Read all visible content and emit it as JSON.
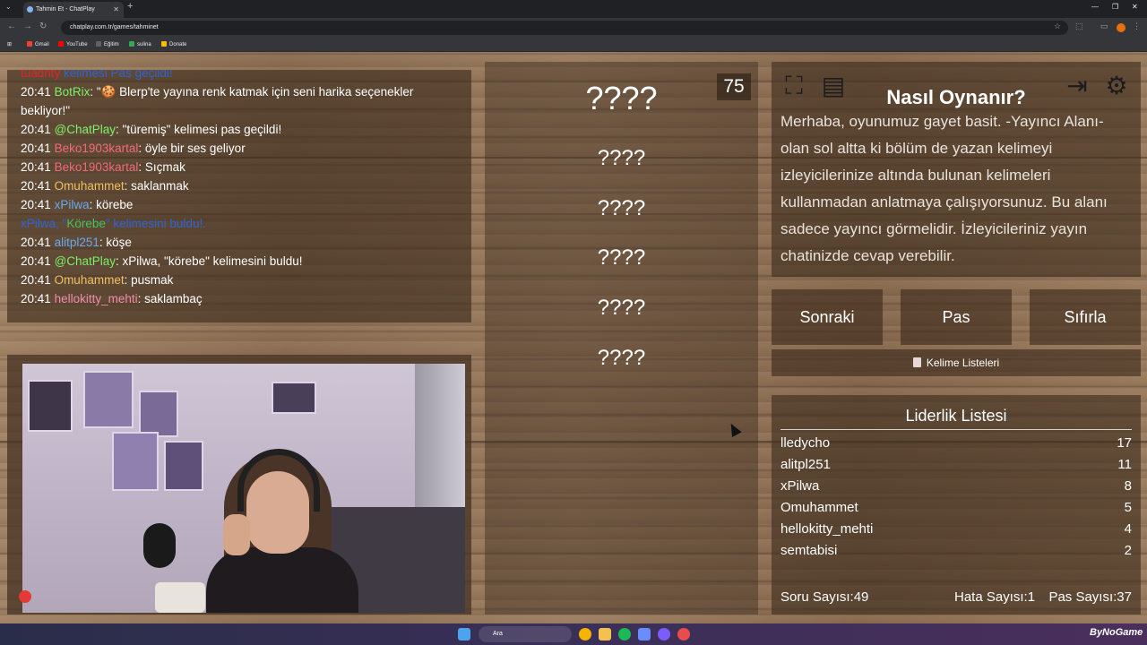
{
  "browser": {
    "tab_title": "Tahmin Et - ChatPlay",
    "url": "chatplay.com.tr/games/tahminet",
    "bookmarks": [
      "Gmail",
      "YouTube",
      "Eğitim",
      "sulina",
      "Donate"
    ],
    "taskbar_search": "Ara",
    "tray_text": "ByNoGame"
  },
  "chat": {
    "cut_line": {
      "user": "tuadnty",
      "text": " kelimesi Pas geçildi!"
    },
    "messages": [
      {
        "time": "20:41",
        "user": "BotRix",
        "color": "#7cf06a",
        "text": ": \"🍪 Blerp'te yayına renk katmak için seni harika seçenekler bekliyor!\""
      },
      {
        "time": "20:41",
        "user": "@ChatPlay",
        "color": "#7cf06a",
        "text": ": \"türemiş\" kelimesi pas geçildi!"
      },
      {
        "time": "20:41",
        "user": "Beko1903kartal",
        "color": "#f06a7a",
        "text": ": öyle bir ses geliyor"
      },
      {
        "time": "20:41",
        "user": "Beko1903kartal",
        "color": "#f06a7a",
        "text": ": Sıçmak"
      },
      {
        "time": "20:41",
        "user": "Omuhammet",
        "color": "#f0c060",
        "text": ": saklanmak"
      },
      {
        "time": "20:41",
        "user": "xPilwa",
        "color": "#6aa8f0",
        "text": ": körebe"
      },
      {
        "system": true,
        "text_pre": "xPilwa, \"",
        "word": "Körebe",
        "text_post": "\" kelimesini buldu!."
      },
      {
        "time": "20:41",
        "user": "alitpl251",
        "color": "#6aa8f0",
        "text": ": köşe"
      },
      {
        "time": "20:41",
        "user": "@ChatPlay",
        "color": "#7cf06a",
        "text": ": xPilwa, \"körebe\" kelimesini buldu!"
      },
      {
        "time": "20:41",
        "user": "Omuhammet",
        "color": "#f0c060",
        "text": ": pusmak"
      },
      {
        "time": "20:41",
        "user": "hellokitty_mehti",
        "color": "#f08aa8",
        "text": ": saklambaç"
      }
    ]
  },
  "game": {
    "timer": "75",
    "words": [
      "????",
      "????",
      "????",
      "????",
      "????",
      "????"
    ]
  },
  "howto": {
    "title": "Nasıl Oynanır?",
    "text": "Merhaba, oyunumuz gayet basit. -Yayıncı Alanı- olan sol altta ki bölüm de yazan kelimeyi izleyicilerinize altında bulunan kelimeleri kullanmadan anlatmaya çalışıyorsunuz. Bu alanı sadece yayıncı görmelidir. İzleyicileriniz yayın chatinizde cevap verebilir.",
    "icons": [
      "fullscreen-icon",
      "notes-icon",
      "exit-icon",
      "gear-icon"
    ]
  },
  "controls": {
    "next": "Sonraki",
    "pass": "Pas",
    "reset": "Sıfırla",
    "word_lists": "Kelime Listeleri"
  },
  "leaderboard": {
    "title": "Liderlik Listesi",
    "rows": [
      {
        "name": "lledycho",
        "score": "17"
      },
      {
        "name": "alitpl251",
        "score": "11"
      },
      {
        "name": "xPilwa",
        "score": "8"
      },
      {
        "name": "Omuhammet",
        "score": "5"
      },
      {
        "name": "hellokitty_mehti",
        "score": "4"
      },
      {
        "name": "semtabisi",
        "score": "2"
      }
    ],
    "questions": "Soru Sayısı:49",
    "errors": "Hata Sayısı:1",
    "passes": "Pas Sayısı:37"
  }
}
